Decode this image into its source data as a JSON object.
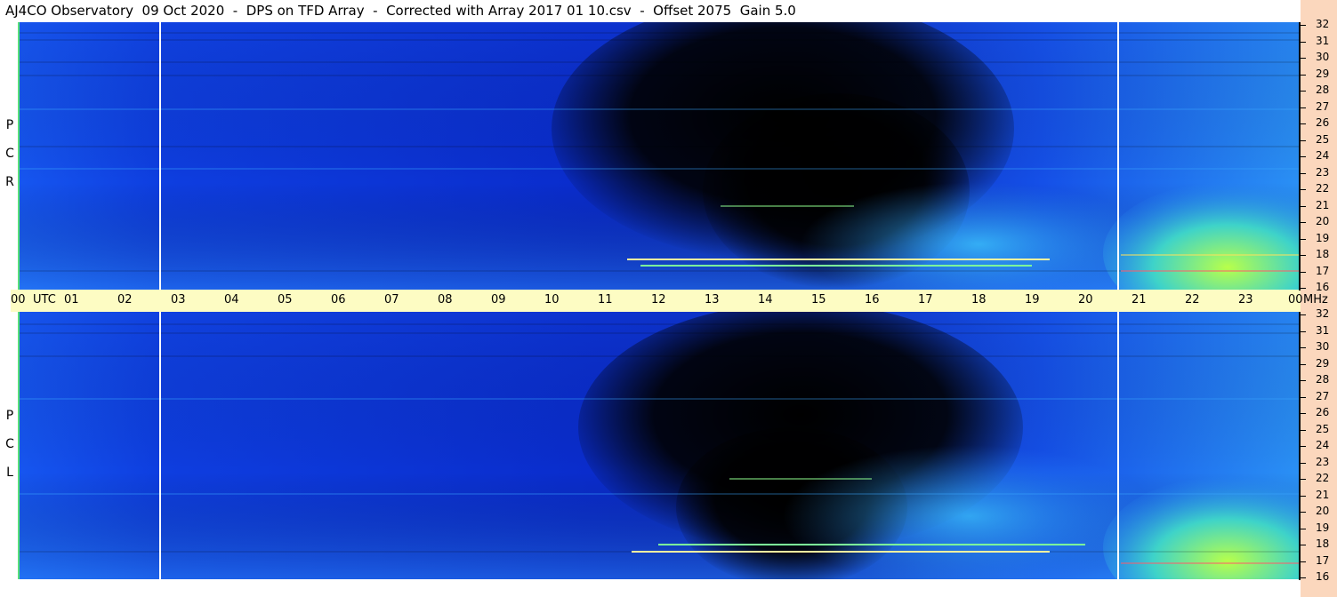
{
  "title": "AJ4CO Observatory  09 Oct 2020  -  DPS on TFD Array  -  Corrected with Array 2017 01 10.csv  -  Offset 2075  Gain 5.0",
  "chart_data": [
    {
      "type": "heatmap",
      "panel": "RCP",
      "polarization_letters": [
        "R",
        "C",
        "P"
      ],
      "x_axis": {
        "label": "UTC",
        "ticks": [
          "00",
          "01",
          "02",
          "03",
          "04",
          "05",
          "06",
          "07",
          "08",
          "09",
          "10",
          "11",
          "12",
          "13",
          "14",
          "15",
          "16",
          "17",
          "18",
          "19",
          "20",
          "21",
          "22",
          "23",
          "00"
        ],
        "range": [
          0,
          24
        ]
      },
      "y_axis": {
        "unit": "MHz",
        "ticks": [
          32,
          31,
          30,
          29,
          28,
          27,
          26,
          25,
          24,
          23,
          22,
          21,
          20,
          19,
          18,
          17,
          16
        ],
        "range": [
          16,
          32
        ]
      },
      "colors": {
        "background": "#0a2fd8",
        "dark": "#000000",
        "mid": "#1f8fff",
        "bright": "#8cff66"
      },
      "gaps_utc": [
        2.7,
        20.6
      ]
    },
    {
      "type": "heatmap",
      "panel": "LCP",
      "polarization_letters": [
        "L",
        "C",
        "P"
      ],
      "x_axis": {
        "label": "UTC",
        "ticks": [
          "00",
          "01",
          "02",
          "03",
          "04",
          "05",
          "06",
          "07",
          "08",
          "09",
          "10",
          "11",
          "12",
          "13",
          "14",
          "15",
          "16",
          "17",
          "18",
          "19",
          "20",
          "21",
          "22",
          "23",
          "00"
        ],
        "range": [
          0,
          24
        ]
      },
      "y_axis": {
        "unit": "MHz",
        "ticks": [
          32,
          31,
          30,
          29,
          28,
          27,
          26,
          25,
          24,
          23,
          22,
          21,
          20,
          19,
          18,
          17,
          16
        ],
        "range": [
          16,
          32
        ]
      },
      "colors": {
        "background": "#0a2fd8",
        "dark": "#000000",
        "mid": "#1f8fff",
        "bright": "#8cff66"
      },
      "gaps_utc": [
        2.7,
        20.6
      ]
    }
  ],
  "utc_axis": {
    "zone_label": "UTC",
    "unit_label": "MHz"
  }
}
